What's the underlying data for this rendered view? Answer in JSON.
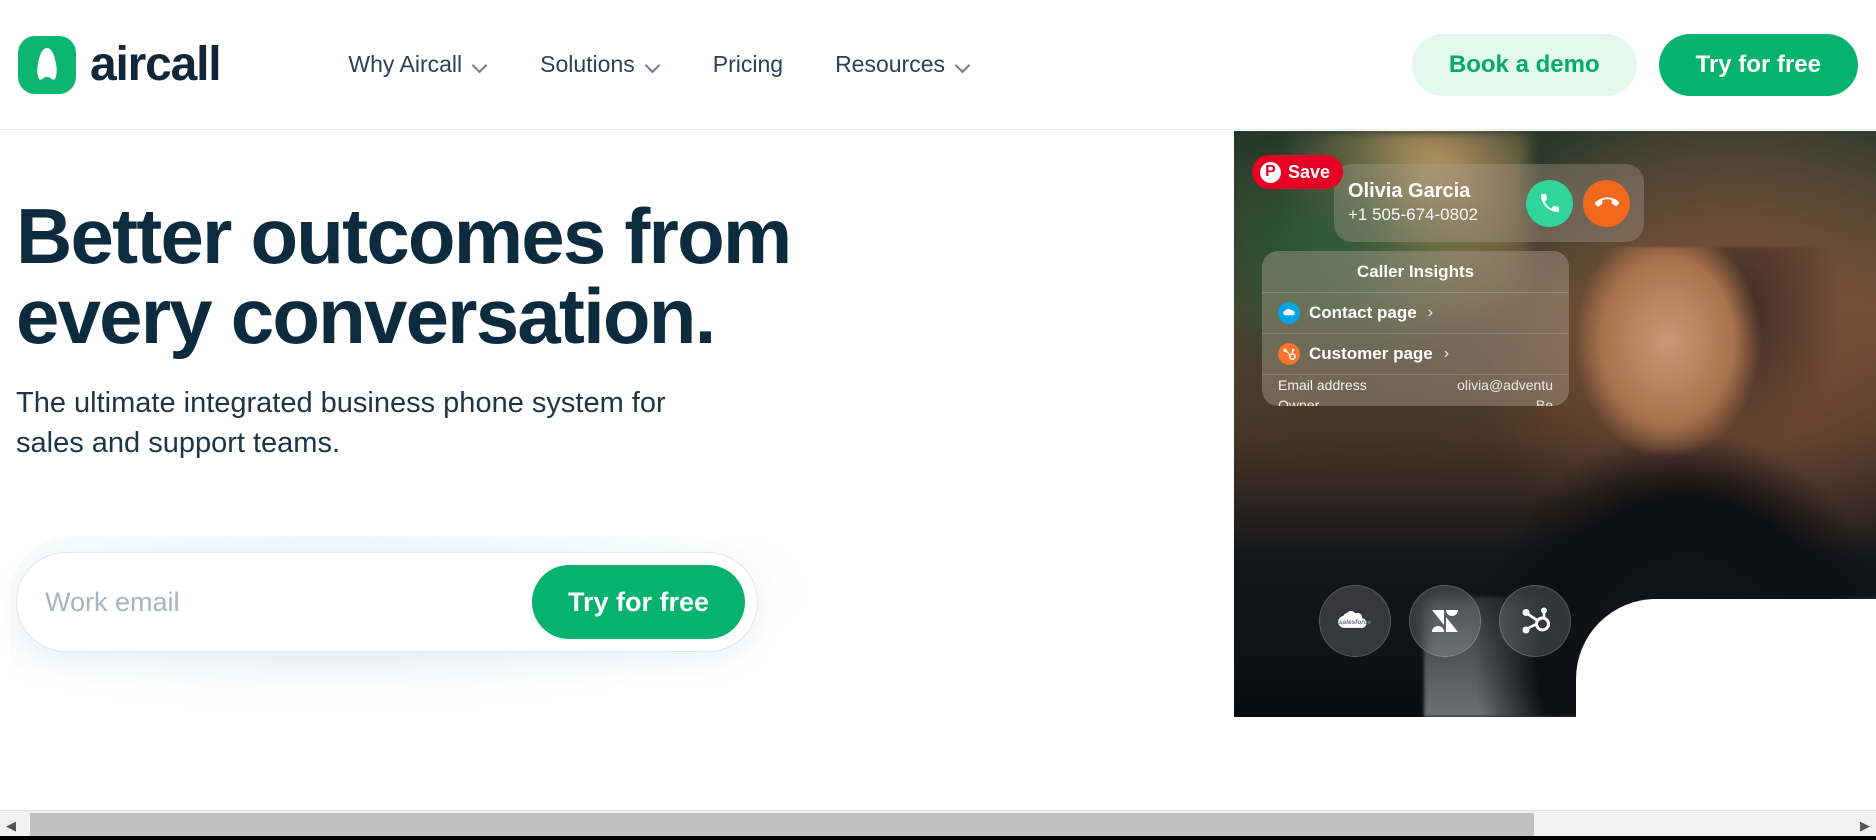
{
  "brand": {
    "name": "aircall",
    "logo_icon": "aircall-logo-icon",
    "green": "#05b36e",
    "mint": "#e2f7ee",
    "navy": "#0c2b3e"
  },
  "header": {
    "nav": [
      {
        "label": "Why Aircall",
        "has_dropdown": true
      },
      {
        "label": "Solutions",
        "has_dropdown": true
      },
      {
        "label": "Pricing",
        "has_dropdown": false
      },
      {
        "label": "Resources",
        "has_dropdown": true
      }
    ],
    "book_demo_label": "Book a demo",
    "try_free_label": "Try for free"
  },
  "hero": {
    "headline_line1": "Better outcomes from",
    "headline_line2": "every conversation.",
    "subhead_line1": "The ultimate integrated business phone system for",
    "subhead_line2": "sales and support teams.",
    "form": {
      "email_placeholder": "Work email",
      "email_value": "",
      "submit_label": "Try for free"
    }
  },
  "media": {
    "pinterest": {
      "label": "Save",
      "icon": "pinterest-icon",
      "color": "#e60023"
    },
    "call_card": {
      "caller_name": "Olivia Garcia",
      "caller_number": "+1 505-674-0802",
      "accept_icon": "phone-icon",
      "decline_icon": "phone-hangup-icon",
      "accept_color": "#2fd59b",
      "decline_color": "#f2681c"
    },
    "insights": {
      "title": "Caller Insights",
      "rows": [
        {
          "label": "Contact page",
          "icon": "salesforce-icon",
          "icon_color": "#0aa5e8"
        },
        {
          "label": "Customer page",
          "icon": "hubspot-icon",
          "icon_color": "#f4762a"
        }
      ],
      "fields": [
        {
          "key": "Email address",
          "value": "olivia@adventu"
        },
        {
          "key": "Owner",
          "value": "Be"
        }
      ]
    },
    "integrations": [
      {
        "name": "salesforce",
        "icon": "salesforce-icon",
        "label": "salesforce"
      },
      {
        "name": "zendesk",
        "icon": "zendesk-icon",
        "label": ""
      },
      {
        "name": "hubspot",
        "icon": "hubspot-icon",
        "label": ""
      }
    ]
  },
  "scrollbar": {
    "left_arrow": "◀",
    "right_arrow": "▶"
  }
}
